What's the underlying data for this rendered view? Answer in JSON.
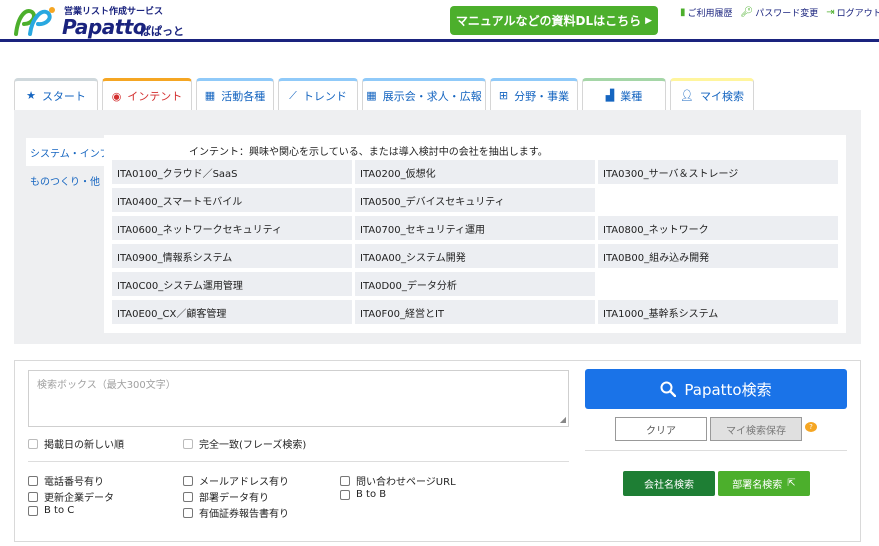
{
  "header": {
    "tagline": "営業リスト作成サービス",
    "brand": "Papatto",
    "brand_kana": "ぱぱっと",
    "dl_button": "マニュアルなどの資料DLはこちら",
    "links": [
      {
        "label": "ご利用履歴",
        "icon": "book-icon"
      },
      {
        "label": "パスワード変更",
        "icon": "key-icon"
      },
      {
        "label": "ログアウト",
        "icon": "logout-icon"
      }
    ]
  },
  "tabs": [
    {
      "label": "スタート",
      "icon": "star-icon",
      "color": "#cfd8dc"
    },
    {
      "label": "インテント",
      "icon": "eye-icon",
      "color": "#f5a623",
      "active": true
    },
    {
      "label": "活動各種",
      "icon": "building-icon",
      "color": "#90caf9"
    },
    {
      "label": "トレンド",
      "icon": "chart-icon",
      "color": "#90caf9"
    },
    {
      "label": "展示会・求人・広報",
      "icon": "building-icon",
      "color": "#90caf9"
    },
    {
      "label": "分野・事業",
      "icon": "grid-icon",
      "color": "#90caf9"
    },
    {
      "label": "業種",
      "icon": "factory-icon",
      "color": "#a5d6a7"
    },
    {
      "label": "マイ検索",
      "icon": "user-icon",
      "color": "#fff59d"
    }
  ],
  "side_menu": [
    {
      "label": "システム・インフラ",
      "active": true
    },
    {
      "label": "ものつくり・他",
      "active": false
    }
  ],
  "intent_description": "インテント：興味や関心を示している、または導入検討中の会社を抽出します。",
  "intent_items": [
    "ITA0100_クラウド／SaaS",
    "ITA0200_仮想化",
    "ITA0300_サーバ＆ストレージ",
    "ITA0400_スマートモバイル",
    "ITA0500_デバイスセキュリティ",
    "",
    "ITA0600_ネットワークセキュリティ",
    "ITA0700_セキュリティ運用",
    "ITA0800_ネットワーク",
    "ITA0900_情報系システム",
    "ITA0A00_システム開発",
    "ITA0B00_組み込み開発",
    "ITA0C00_システム運用管理",
    "ITA0D00_データ分析",
    "",
    "ITA0E00_CX／顧客管理",
    "ITA0F00_経営とIT",
    "ITA1000_基幹系システム"
  ],
  "search": {
    "placeholder": "検索ボックス（最大300文字）",
    "value": "",
    "opt_new_order": "掲載日の新しい順",
    "opt_exact": "完全一致(フレーズ検索)",
    "filters": [
      "電話番号有り",
      "メールアドレス有り",
      "問い合わせページURL",
      "更新企業データ",
      "部署データ有り",
      "B to B",
      "B to C",
      "有価証券報告書有り"
    ],
    "search_button": "Papatto検索",
    "clear_button": "クリア",
    "save_button": "マイ検索保存",
    "help_icon_text": "?",
    "company_search": "会社名検索",
    "dept_search": "部署名検索"
  },
  "colors": {
    "brand_navy": "#1a237e",
    "green": "#4caf2c",
    "dark_green": "#1e7e34",
    "search_blue": "#1a73e8",
    "active_tab_text": "#d32f2f"
  }
}
